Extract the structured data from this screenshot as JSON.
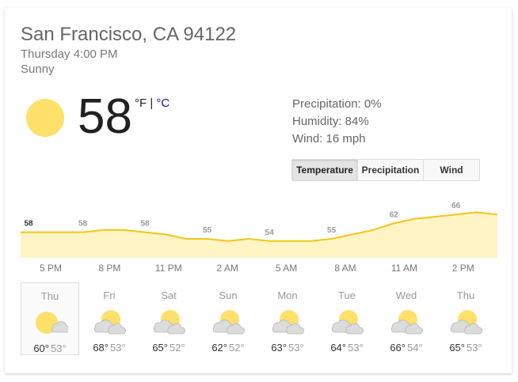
{
  "location": "San Francisco, CA 94122",
  "time": "Thursday 4:00 PM",
  "condition": "Sunny",
  "current": {
    "temp": "58",
    "unit_f": "°F",
    "separator": "|",
    "unit_c": "°C",
    "icon": "sun-icon"
  },
  "details": {
    "precipitation": "Precipitation: 0%",
    "humidity": "Humidity: 84%",
    "wind": "Wind: 16 mph"
  },
  "tabs": [
    {
      "label": "Temperature",
      "active": true
    },
    {
      "label": "Precipitation",
      "active": false
    },
    {
      "label": "Wind",
      "active": false
    }
  ],
  "chart_data": {
    "type": "area",
    "title": "",
    "hours": [
      "5 PM",
      "8 PM",
      "11 PM",
      "2 AM",
      "5 AM",
      "8 AM",
      "11 AM",
      "2 PM"
    ],
    "labeled_values": [
      "58",
      "58",
      "58",
      "55",
      "54",
      "55",
      "62",
      "66"
    ],
    "series": [
      {
        "values": [
          58,
          58,
          58,
          58,
          59,
          59,
          58,
          57,
          55,
          55,
          54,
          55,
          54,
          54,
          54,
          55,
          57,
          59,
          62,
          64,
          65,
          66,
          67,
          66
        ]
      }
    ],
    "colors": {
      "line": "#f5c518",
      "fill": "#fff4c4"
    },
    "ylim": [
      50,
      70
    ]
  },
  "days": [
    {
      "name": "Thu",
      "hi": "60°",
      "lo": "53°",
      "icon": "sunny-icon",
      "selected": true
    },
    {
      "name": "Fri",
      "hi": "68°",
      "lo": "53°",
      "icon": "partly-cloudy-icon",
      "selected": false
    },
    {
      "name": "Sat",
      "hi": "65°",
      "lo": "52°",
      "icon": "partly-cloudy-icon",
      "selected": false
    },
    {
      "name": "Sun",
      "hi": "62°",
      "lo": "52°",
      "icon": "partly-cloudy-icon",
      "selected": false
    },
    {
      "name": "Mon",
      "hi": "63°",
      "lo": "53°",
      "icon": "partly-cloudy-icon",
      "selected": false
    },
    {
      "name": "Tue",
      "hi": "64°",
      "lo": "53°",
      "icon": "partly-cloudy-icon",
      "selected": false
    },
    {
      "name": "Wed",
      "hi": "66°",
      "lo": "54°",
      "icon": "partly-cloudy-icon",
      "selected": false
    },
    {
      "name": "Thu",
      "hi": "65°",
      "lo": "53°",
      "icon": "partly-cloudy-icon",
      "selected": false
    }
  ]
}
